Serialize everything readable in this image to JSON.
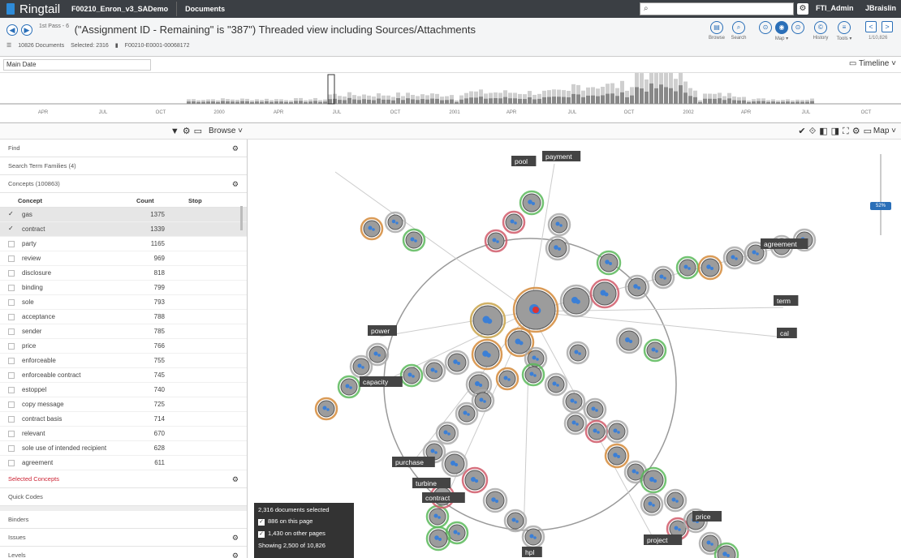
{
  "app": {
    "name": "Ringtail",
    "case_name": "F00210_Enron_v3_SADemo",
    "module": "Documents"
  },
  "top_right": {
    "gear_glyph": "⚙",
    "user1": "FTI_Admin",
    "user2": "JBraislin"
  },
  "header": {
    "sub": "1st Pass - 6",
    "title": "(\"Assignment ID - Remaining\" is \"387\") Threaded view including Sources/Attachments",
    "doc_count": "10826 Documents",
    "selected": "Selected: 2316",
    "doc_id": "F00210-E0001-00068172"
  },
  "tools": [
    {
      "label": "Browse",
      "glyph": "▤",
      "filled": false
    },
    {
      "label": "Search",
      "glyph": "⌕",
      "filled": false
    },
    {
      "label": "",
      "glyph": "⊙",
      "filled": false
    },
    {
      "label": "Map ▾",
      "glyph": "◉",
      "filled": true
    },
    {
      "label": "",
      "glyph": "⊙",
      "filled": false
    },
    {
      "label": "History",
      "glyph": "©",
      "filled": false
    },
    {
      "label": "Tools ▾",
      "glyph": "≡",
      "filled": false
    }
  ],
  "paging": {
    "value": "1/10,826"
  },
  "timeline": {
    "field": "Main Date",
    "label": "Timeline ˅",
    "labels": [
      "APR",
      "JUL",
      "OCT",
      "2000",
      "APR",
      "JUL",
      "OCT",
      "2001",
      "APR",
      "JUL",
      "OCT",
      "2002",
      "APR",
      "JUL",
      "OCT"
    ]
  },
  "left_pane": {
    "browse_label": "Browse ˅",
    "find_label": "Find",
    "search_term_families": "Search Term Families (4)",
    "concepts_header": "Concepts (100863)",
    "col_concept": "Concept",
    "col_count": "Count",
    "col_stop": "Stop",
    "concepts": [
      {
        "name": "gas",
        "count": "1375",
        "checked": true
      },
      {
        "name": "contract",
        "count": "1339",
        "checked": true
      },
      {
        "name": "party",
        "count": "1165",
        "checked": false
      },
      {
        "name": "review",
        "count": "969",
        "checked": false
      },
      {
        "name": "disclosure",
        "count": "818",
        "checked": false
      },
      {
        "name": "binding",
        "count": "799",
        "checked": false
      },
      {
        "name": "sole",
        "count": "793",
        "checked": false
      },
      {
        "name": "acceptance",
        "count": "788",
        "checked": false
      },
      {
        "name": "sender",
        "count": "785",
        "checked": false
      },
      {
        "name": "price",
        "count": "766",
        "checked": false
      },
      {
        "name": "enforceable",
        "count": "755",
        "checked": false
      },
      {
        "name": "enforceable contract",
        "count": "745",
        "checked": false
      },
      {
        "name": "estoppel",
        "count": "740",
        "checked": false
      },
      {
        "name": "copy message",
        "count": "725",
        "checked": false
      },
      {
        "name": "contract basis",
        "count": "714",
        "checked": false
      },
      {
        "name": "relevant",
        "count": "670",
        "checked": false
      },
      {
        "name": "sole use of intended recipient",
        "count": "628",
        "checked": false
      },
      {
        "name": "agreement",
        "count": "611",
        "checked": false
      }
    ],
    "selected_concepts": "Selected Concepts",
    "quick_codes": "Quick Codes",
    "binders": "Binders",
    "issues": "Issues",
    "levels": "Levels"
  },
  "map": {
    "label": "Map ˅",
    "zoom_value": "52%",
    "concept_labels": [
      "payment",
      "pool",
      "agreement",
      "term",
      "cal",
      "power",
      "capacity",
      "purchase",
      "turbine",
      "contract",
      "price",
      "project",
      "hpl"
    ]
  },
  "popup": {
    "line1": "2,316 documents selected",
    "line2": "886 on this page",
    "line3": "1,430 on other pages",
    "line4": "Showing 2,500 of 10,826"
  },
  "colors": {
    "accent": "#2a6fb8",
    "topbar": "#3b3f44",
    "red_text": "#c23"
  }
}
